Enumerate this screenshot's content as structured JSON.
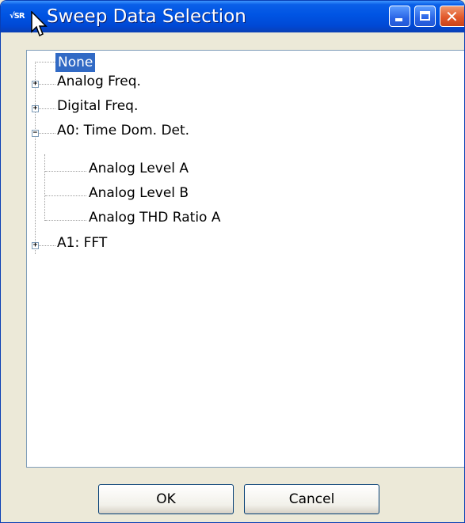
{
  "window": {
    "title": "Sweep Data Selection",
    "app_icon_text": "√SR"
  },
  "tree": {
    "items": [
      {
        "label": "None",
        "selected": true,
        "expander": null
      },
      {
        "label": "Analog Freq.",
        "expander": "+"
      },
      {
        "label": "Digital Freq.",
        "expander": "+"
      },
      {
        "label": "A0: Time Dom. Det.",
        "expander": "−"
      },
      {
        "label": "Analog Level A",
        "child": true
      },
      {
        "label": "Analog Level B",
        "child": true
      },
      {
        "label": "Analog THD Ratio A",
        "child": true
      },
      {
        "label": "A1: FFT",
        "expander": "+"
      }
    ]
  },
  "buttons": {
    "ok": "OK",
    "cancel": "Cancel"
  },
  "colors": {
    "titlebar": "#0054e3",
    "selection": "#316ac5",
    "close": "#e25a2b"
  }
}
